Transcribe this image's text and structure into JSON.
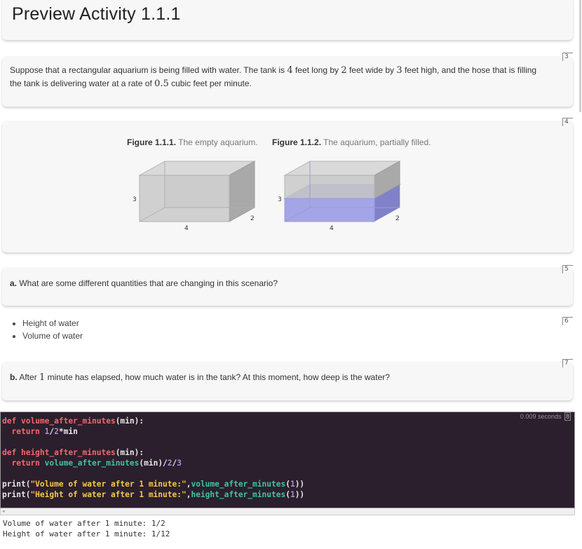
{
  "header": {
    "title": "Preview Activity 1.1.1"
  },
  "intro": {
    "p1": "Suppose that a rectangular aquarium is being filled with water. The tank is ",
    "len": "4",
    "p2": " feet long by ",
    "wid": "2",
    "p3": " feet wide by ",
    "hgt": "3",
    "p4": " feet high, and the hose that is filling",
    "p5": "the tank is delivering water at a rate of ",
    "rate": "0.5",
    "p6": " cubic feet per minute."
  },
  "figures": {
    "fig1": {
      "label": "Figure 1.1.1.",
      "caption": " The empty aquarium."
    },
    "fig2": {
      "label": "Figure 1.1.2.",
      "caption": " The aquarium, partially filled."
    },
    "dims": {
      "height": "3",
      "length": "4",
      "width": "2"
    }
  },
  "questions": {
    "a": {
      "label": "a.",
      "text": " What are some different quantities that are changing in this scenario?"
    },
    "b": {
      "label": "b.",
      "pre": " After ",
      "num": "1",
      "post": " minute has elapsed, how much water is in the tank? At this moment, how deep is the water?"
    }
  },
  "answers": [
    "Height of water",
    "Volume of water"
  ],
  "cell_numbers": [
    "3",
    "4",
    "5",
    "6",
    "7",
    "8"
  ],
  "code": {
    "timer": "0.009 seconds",
    "lines": {
      "l1_kw": "def",
      "l1_fn": "volume_after_minutes",
      "l1_rest": "(min):",
      "l2_kw": "return",
      "l2_n1": "1",
      "l2_op": "/",
      "l2_n2": "2",
      "l2_rest": "*min",
      "l4_kw": "def",
      "l4_fn": "height_after_minutes",
      "l4_rest": "(min):",
      "l5_kw": "return",
      "l5_call": "volume_after_minutes",
      "l5_arg": "(min)/",
      "l5_n1": "2",
      "l5_op": "/",
      "l5_n2": "3",
      "l7_fn": "print",
      "l7_str": "\"Volume of water after 1 minute:\"",
      "l7_call": "volume_after_minutes",
      "l7_n": "1",
      "l8_fn": "print",
      "l8_str": "\"Height of water after 1 minute:\"",
      "l8_call": "height_after_minutes",
      "l8_n": "1"
    }
  },
  "output": [
    "Volume of water after 1 minute: 1/2",
    "Height of water after 1 minute: 1/12"
  ]
}
